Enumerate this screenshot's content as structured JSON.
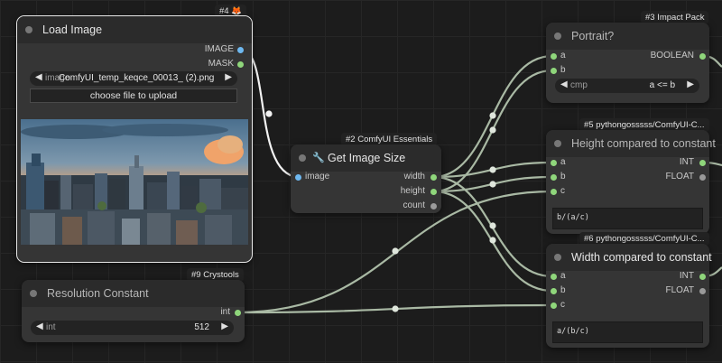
{
  "colors": {
    "canvas": "#1c1c1c",
    "node_body": "#353535",
    "node_title": "#2b2b2b",
    "link": "#a9b9a4",
    "slot_green": "#8fd67b",
    "slot_blue": "#6eb8f0",
    "slot_unconnected": "#9a9a9a"
  },
  "nodes": {
    "load_image": {
      "badge": "#4 🦊",
      "title": "Load Image",
      "outputs": [
        "IMAGE",
        "MASK"
      ],
      "image_widget": {
        "label": "image",
        "value": "ComfyUI_temp_keqce_00013_ (2).png"
      },
      "upload_button": "choose file to upload",
      "preview_icon": "city-skyline-image"
    },
    "get_image_size": {
      "badge": "#2 ComfyUI Essentials",
      "title": "Get Image Size",
      "title_icon": "wrench-icon",
      "inputs": [
        "image"
      ],
      "outputs": [
        "width",
        "height",
        "count"
      ]
    },
    "resolution_constant": {
      "badge": "#9 Crystools",
      "title": "Resolution Constant",
      "outputs": [
        "int"
      ],
      "int_widget": {
        "label": "int",
        "value": "512"
      }
    },
    "portrait": {
      "badge": "#3 Impact Pack",
      "title": "Portrait?",
      "inputs": [
        "a",
        "b"
      ],
      "outputs": [
        "BOOLEAN"
      ],
      "cmp_widget": {
        "label": "cmp",
        "value": "a <= b"
      }
    },
    "height_compared": {
      "badge": "#5 pythongosssss/ComfyUI-C...",
      "title": "Height compared to constant",
      "inputs": [
        "a",
        "b",
        "c"
      ],
      "outputs": [
        "INT",
        "FLOAT"
      ],
      "expression": "b/(a/c)"
    },
    "width_compared": {
      "badge": "#6 pythongosssss/ComfyUI-C...",
      "title": "Width compared to constant",
      "inputs": [
        "a",
        "b",
        "c"
      ],
      "outputs": [
        "INT",
        "FLOAT"
      ],
      "expression": "a/(b/c)"
    }
  }
}
